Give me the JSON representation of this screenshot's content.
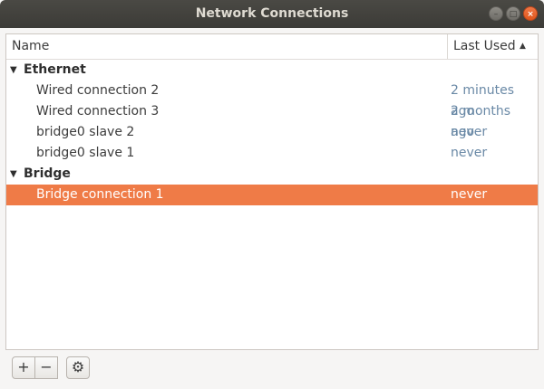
{
  "window": {
    "title": "Network Connections"
  },
  "columns": {
    "name": "Name",
    "last_used": "Last Used"
  },
  "groups": [
    {
      "label": "Ethernet",
      "items": [
        {
          "name": "Wired connection 2",
          "last_used": "2 minutes ago"
        },
        {
          "name": "Wired connection 3",
          "last_used": "2 months ago"
        },
        {
          "name": "bridge0 slave 2",
          "last_used": "never"
        },
        {
          "name": "bridge0 slave 1",
          "last_used": "never"
        }
      ]
    },
    {
      "label": "Bridge",
      "items": [
        {
          "name": "Bridge connection 1",
          "last_used": "never",
          "selected": true
        }
      ]
    }
  ],
  "toolbar": {
    "add_icon": "+",
    "remove_icon": "−",
    "settings_icon": "⚙"
  },
  "colors": {
    "selection": "#ef7b47",
    "timestamp": "#6a89a6"
  }
}
